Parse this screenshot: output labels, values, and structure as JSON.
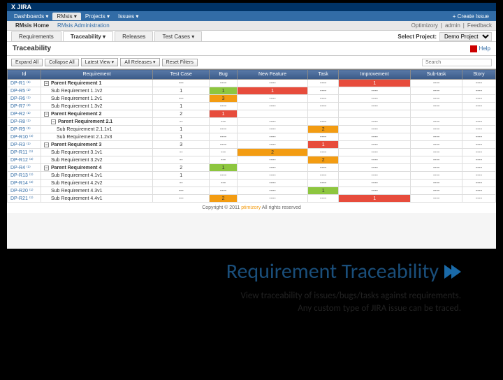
{
  "header": {
    "logo": "X JIRA"
  },
  "nav": {
    "items": [
      "Dashboards ▾",
      "RMsis ▾",
      "Projects ▾",
      "Issues ▾"
    ],
    "create": "+ Create Issue"
  },
  "plugin": {
    "home": "RMsis Home",
    "admin": "RMsis Administration",
    "right": [
      "Optimizory",
      "admin",
      "Feedback"
    ]
  },
  "tabs": {
    "items": [
      "Requirements",
      "Traceability ▾",
      "Releases",
      "Test Cases ▾"
    ],
    "active": 1,
    "selectLabel": "Select Project:",
    "project": "Demo Project"
  },
  "page": {
    "title": "Traceability",
    "help": "Help"
  },
  "toolbar": {
    "buttons": [
      "Expand All",
      "Collapse All",
      "Latest View ▾",
      "All Releases ▾",
      "Reset Filters"
    ],
    "searchPlaceholder": "Search"
  },
  "columns": [
    "Id",
    "Requirement",
    "Test Case",
    "Bug",
    "New Feature",
    "Task",
    "Improvement",
    "Sub-task",
    "Story"
  ],
  "rows": [
    {
      "id": "DP-R1 ⁽¹⁾",
      "name": "Parent Requirement 1",
      "level": 0,
      "parent": true,
      "cells": [
        "---",
        "----",
        "----",
        "----",
        {
          "v": "1",
          "c": "red"
        },
        "----",
        "----"
      ]
    },
    {
      "id": "DP-R5 ⁽²⁾",
      "name": "Sub Requirement 1.1v2",
      "level": 1,
      "cells": [
        "1",
        {
          "v": "1",
          "c": "green"
        },
        {
          "v": "1",
          "c": "red"
        },
        "----",
        "----",
        "----",
        "----"
      ]
    },
    {
      "id": "DP-R6 ⁽¹⁾",
      "name": "Sub Requirement 1.2v1",
      "level": 1,
      "cells": [
        "---",
        {
          "v": "3",
          "c": "orange"
        },
        "----",
        "----",
        "----",
        "----",
        "----"
      ]
    },
    {
      "id": "DP-R7 ⁽²⁾",
      "name": "Sub Requirement 1.3v2",
      "level": 1,
      "cells": [
        "1",
        "----",
        "----",
        "----",
        "----",
        "----",
        "----"
      ]
    },
    {
      "id": "DP-R2 ⁽¹⁾",
      "name": "Parent Requirement 2",
      "level": 0,
      "parent": true,
      "cells": [
        "2",
        {
          "v": "1",
          "c": "red"
        },
        "",
        "",
        "",
        "",
        ""
      ]
    },
    {
      "id": "DP-R8 ⁽¹⁾",
      "name": "Parent Requirement 2.1",
      "level": 1,
      "parent": true,
      "cells": [
        "--",
        "---",
        "----",
        "----",
        "----",
        "----",
        "----"
      ]
    },
    {
      "id": "DP-R9 ⁽¹⁾",
      "name": "Sub Requirement 2.1.1v1",
      "level": 2,
      "cells": [
        "1",
        "----",
        "----",
        {
          "v": "2",
          "c": "orange"
        },
        "----",
        "----",
        "----"
      ]
    },
    {
      "id": "DP-R10 ⁽³⁾",
      "name": "Sub Requirement 2.1.2v3",
      "level": 2,
      "cells": [
        "1",
        "----",
        "----",
        "----",
        "----",
        "----",
        "----"
      ]
    },
    {
      "id": "DP-R3 ⁽¹⁾",
      "name": "Parent Requirement 3",
      "level": 0,
      "parent": true,
      "cells": [
        "3",
        "----",
        "----",
        {
          "v": "1",
          "c": "red"
        },
        "----",
        "----",
        "----"
      ]
    },
    {
      "id": "DP-R11 ⁽¹⁾",
      "name": "Sub Requirement 3.1v1",
      "level": 1,
      "cells": [
        "--",
        "---",
        {
          "v": "2",
          "c": "orange"
        },
        "----",
        "----",
        "----",
        "----"
      ]
    },
    {
      "id": "DP-R12 ⁽²⁾",
      "name": "Sub Requirement 3.2v2",
      "level": 1,
      "cells": [
        "--",
        "---",
        "----",
        {
          "v": "2",
          "c": "orange"
        },
        "----",
        "----",
        "----"
      ]
    },
    {
      "id": "DP-R4 ⁽¹⁾",
      "name": "Parent Requirement 4",
      "level": 0,
      "parent": true,
      "cells": [
        "2",
        {
          "v": "1",
          "c": "green"
        },
        "----",
        "----",
        "----",
        "----",
        "----"
      ]
    },
    {
      "id": "DP-R13 ⁽¹⁾",
      "name": "Sub Requirement 4.1v1",
      "level": 1,
      "cells": [
        "1",
        "----",
        "----",
        "----",
        "----",
        "----",
        "----"
      ]
    },
    {
      "id": "DP-R14 ⁽²⁾",
      "name": "Sub Requirement 4.2v2",
      "level": 1,
      "cells": [
        "--",
        "---",
        "----",
        "----",
        "----",
        "----",
        "----"
      ]
    },
    {
      "id": "DP-R20 ⁽¹⁾",
      "name": "Sub Requirement 4.3v1",
      "level": 1,
      "cells": [
        "---",
        "----",
        "----",
        {
          "v": "1",
          "c": "green"
        },
        "----",
        "----",
        "----"
      ]
    },
    {
      "id": "DP-R21 ⁽¹⁾",
      "name": "Sub Requirement 4.4v1",
      "level": 1,
      "cells": [
        "---",
        {
          "v": "2",
          "c": "orange"
        },
        "----",
        "----",
        {
          "v": "1",
          "c": "red"
        },
        "----",
        "----"
      ]
    }
  ],
  "footer": {
    "text": "Copyright © 2011",
    "brand": "ptimizory",
    "suffix": "All rights reserved"
  },
  "caption": {
    "title": "Requirement Traceability",
    "line1": "View traceability of issues/bugs/tasks against requirements.",
    "line2": "Any custom type of JIRA issue can be traced."
  }
}
